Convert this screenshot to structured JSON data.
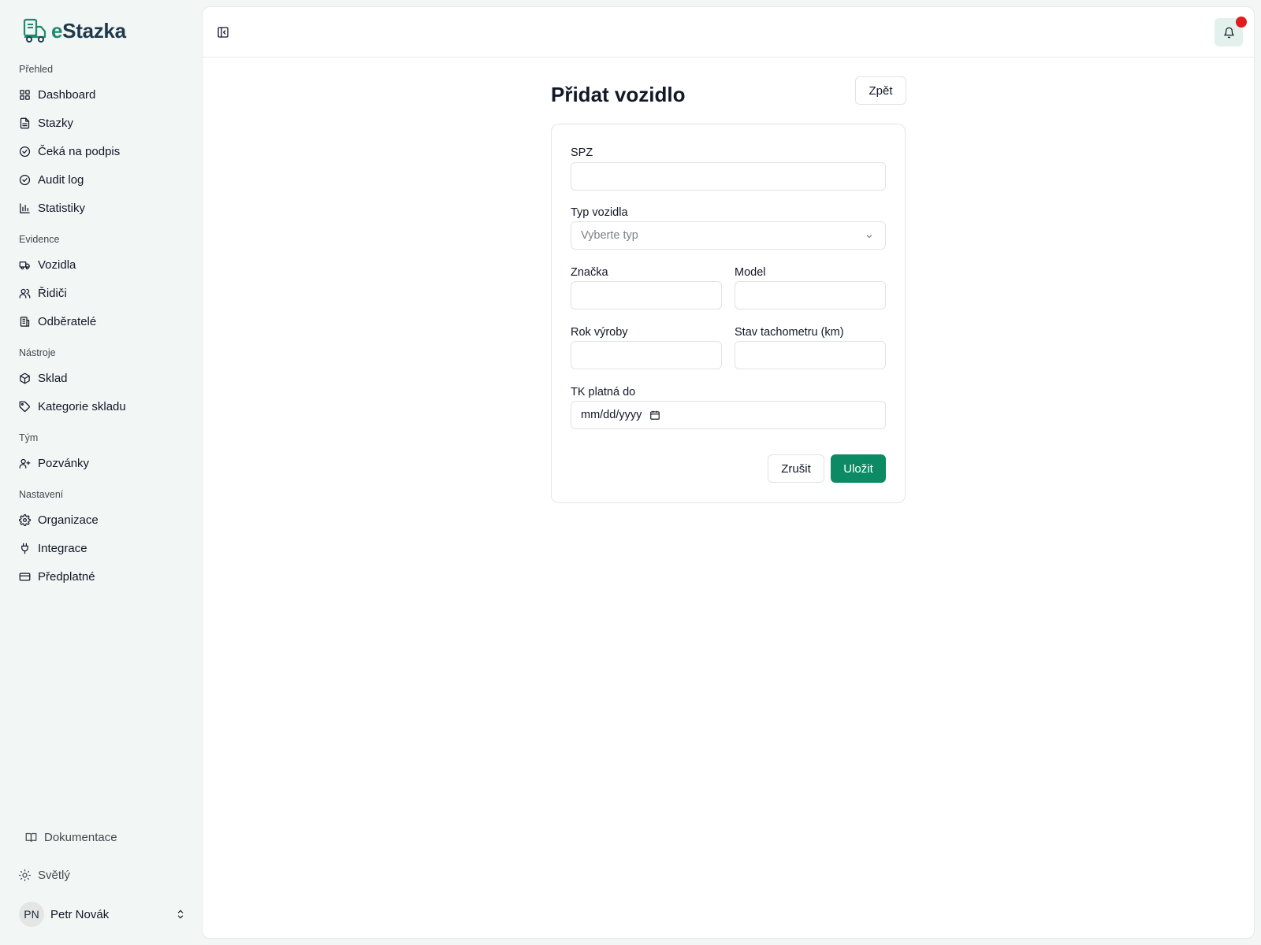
{
  "brand": {
    "prefix": "e",
    "name": "Stazka"
  },
  "colors": {
    "accent": "#0c8a63",
    "notification": "#e11d1d"
  },
  "sidebar": {
    "sections": [
      {
        "label": "Přehled",
        "items": [
          {
            "label": "Dashboard",
            "icon": "grid-icon"
          },
          {
            "label": "Stazky",
            "icon": "document-icon"
          },
          {
            "label": "Čeká na podpis",
            "icon": "check-circle-icon"
          },
          {
            "label": "Audit log",
            "icon": "check-circle-icon"
          },
          {
            "label": "Statistiky",
            "icon": "bar-chart-icon"
          }
        ]
      },
      {
        "label": "Evidence",
        "items": [
          {
            "label": "Vozidla",
            "icon": "truck-icon"
          },
          {
            "label": "Řidiči",
            "icon": "users-icon"
          },
          {
            "label": "Odběratelé",
            "icon": "building-icon"
          }
        ]
      },
      {
        "label": "Nástroje",
        "items": [
          {
            "label": "Sklad",
            "icon": "box-icon"
          },
          {
            "label": "Kategorie skladu",
            "icon": "tag-icon"
          }
        ]
      },
      {
        "label": "Tým",
        "items": [
          {
            "label": "Pozvánky",
            "icon": "user-plus-icon"
          }
        ]
      },
      {
        "label": "Nastavení",
        "items": [
          {
            "label": "Organizace",
            "icon": "gear-icon"
          },
          {
            "label": "Integrace",
            "icon": "plug-icon"
          },
          {
            "label": "Předplatné",
            "icon": "credit-card-icon"
          }
        ]
      }
    ],
    "footer": {
      "docs_label": "Dokumentace",
      "theme_label": "Světlý",
      "user_initials": "PN",
      "user_name": "Petr Novák"
    }
  },
  "page": {
    "title": "Přidat vozidlo",
    "back_label": "Zpět",
    "form": {
      "spz_label": "SPZ",
      "spz_value": "",
      "type_label": "Typ vozidla",
      "type_placeholder": "Vyberte typ",
      "brand_label": "Značka",
      "brand_value": "",
      "model_label": "Model",
      "model_value": "",
      "year_label": "Rok výroby",
      "year_value": "",
      "odometer_label": "Stav tachometru (km)",
      "odometer_value": "",
      "tk_label": "TK platná do",
      "tk_placeholder": "mm/dd/yyyy",
      "cancel_label": "Zrušit",
      "save_label": "Uložit"
    }
  }
}
